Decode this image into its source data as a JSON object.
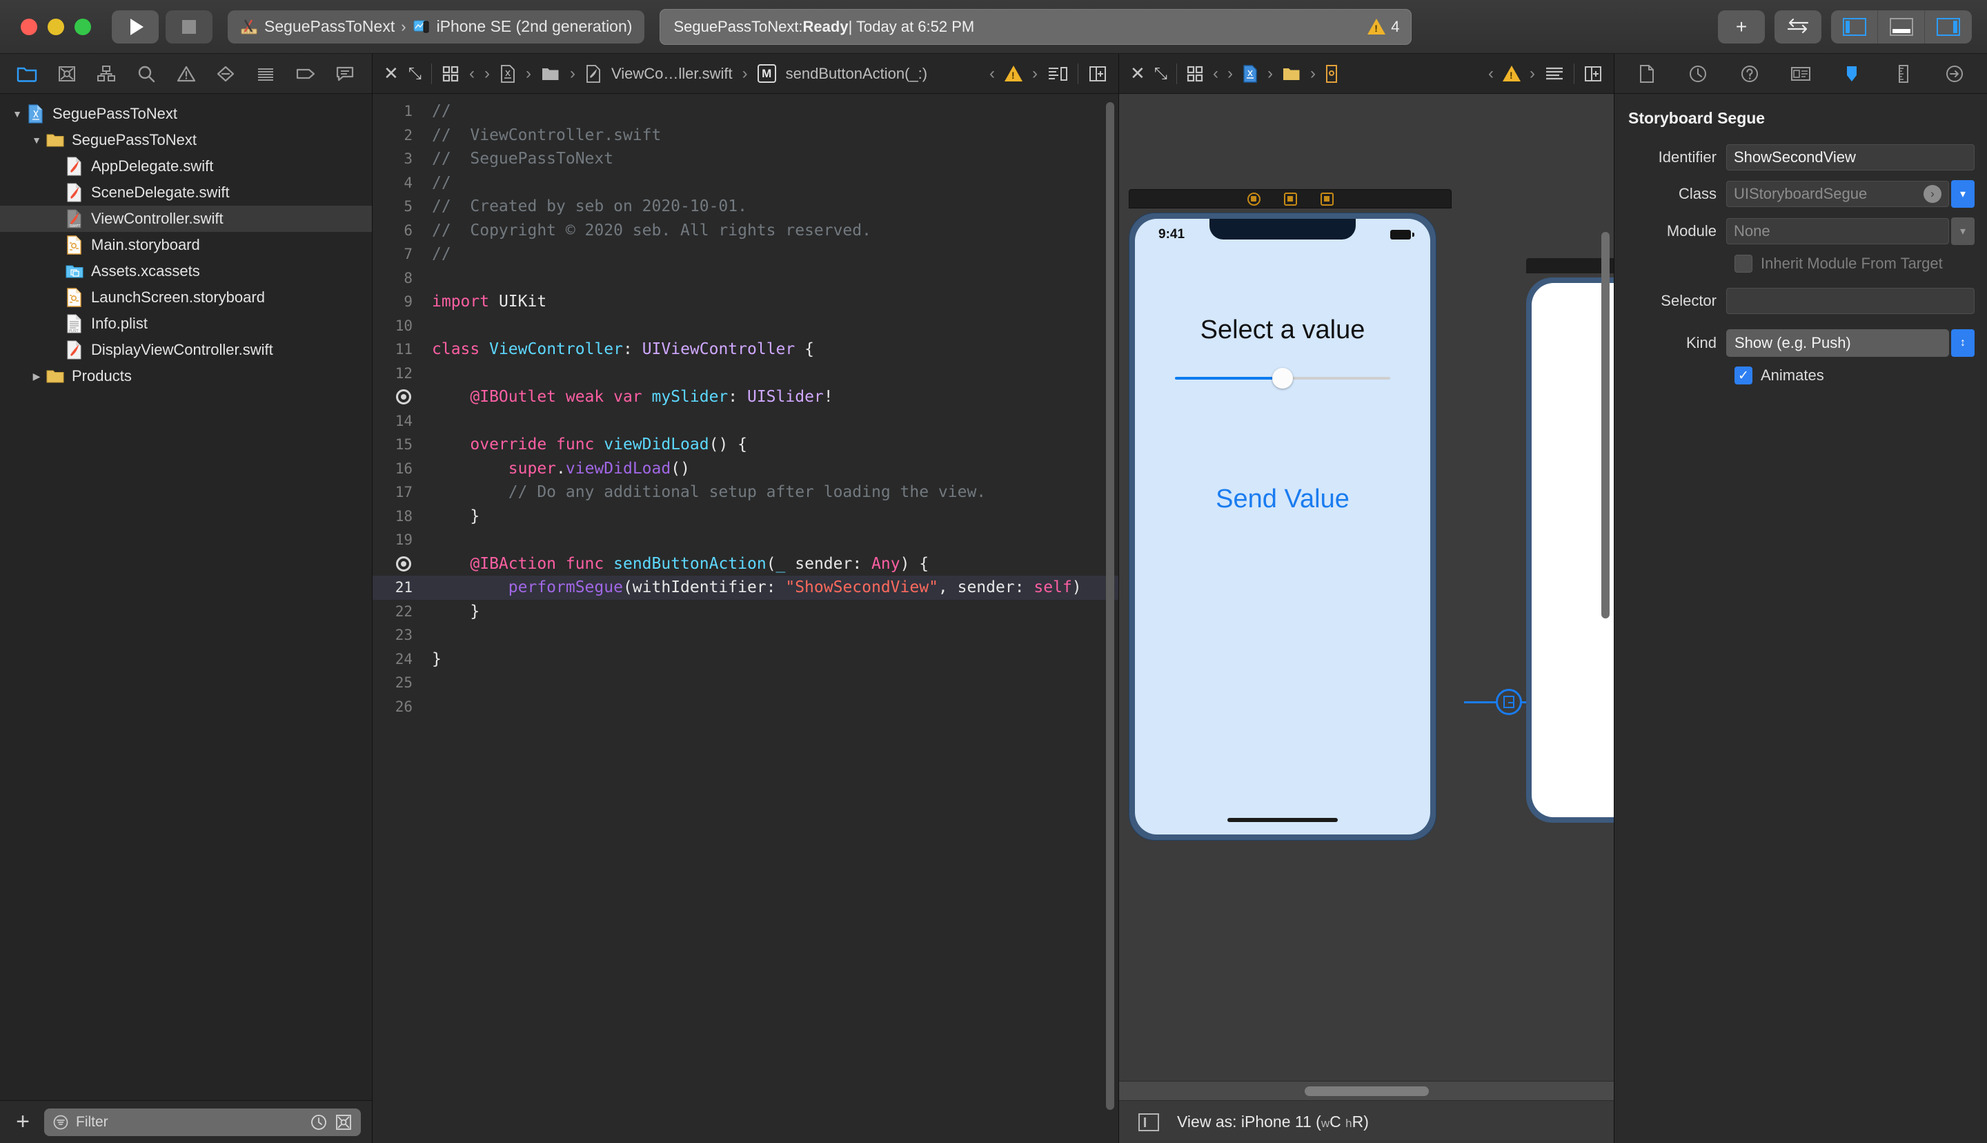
{
  "toolbar": {
    "run_label": "Run",
    "stop_label": "Stop",
    "scheme_project": "SeguePassToNext",
    "scheme_sep": "›",
    "scheme_device": "iPhone SE (2nd generation)",
    "status_project": "SeguePassToNext: ",
    "status_state": "Ready",
    "status_time": " | Today at 6:52 PM",
    "warning_count": "4",
    "add_label": "+",
    "toggle_label": "⇆",
    "pane_left_title": "Navigator",
    "pane_bottom_title": "Debug Area",
    "pane_right_title": "Inspector"
  },
  "navigator": {
    "tabs": [
      {
        "name": "folder-icon",
        "title": "Project navigator",
        "active": true
      },
      {
        "name": "source-control-icon",
        "title": "Source Control navigator",
        "active": false
      },
      {
        "name": "hierarchy-icon",
        "title": "Symbol navigator",
        "active": false
      },
      {
        "name": "search-icon",
        "title": "Find navigator",
        "active": false
      },
      {
        "name": "warning-triangle-icon",
        "title": "Issue navigator",
        "active": false
      },
      {
        "name": "test-diamond-icon",
        "title": "Test navigator",
        "active": false
      },
      {
        "name": "debug-list-icon",
        "title": "Debug navigator",
        "active": false
      },
      {
        "name": "tag-icon",
        "title": "Breakpoint navigator",
        "active": false
      },
      {
        "name": "report-bubble-icon",
        "title": "Report navigator",
        "active": false
      }
    ],
    "tree": [
      {
        "label": "SeguePassToNext",
        "indent": 0,
        "twisty": "down",
        "icon": "xcodeproj",
        "selected": false
      },
      {
        "label": "SeguePassToNext",
        "indent": 1,
        "twisty": "down",
        "icon": "folder",
        "selected": false
      },
      {
        "label": "AppDelegate.swift",
        "indent": 2,
        "twisty": "none",
        "icon": "swift",
        "selected": false
      },
      {
        "label": "SceneDelegate.swift",
        "indent": 2,
        "twisty": "none",
        "icon": "swift",
        "selected": false
      },
      {
        "label": "ViewController.swift",
        "indent": 2,
        "twisty": "none",
        "icon": "swift-gray",
        "selected": true
      },
      {
        "label": "Main.storyboard",
        "indent": 2,
        "twisty": "none",
        "icon": "storyboard",
        "selected": false
      },
      {
        "label": "Assets.xcassets",
        "indent": 2,
        "twisty": "none",
        "icon": "xcassets",
        "selected": false
      },
      {
        "label": "LaunchScreen.storyboard",
        "indent": 2,
        "twisty": "none",
        "icon": "storyboard",
        "selected": false
      },
      {
        "label": "Info.plist",
        "indent": 2,
        "twisty": "none",
        "icon": "plist",
        "selected": false
      },
      {
        "label": "DisplayViewController.swift",
        "indent": 2,
        "twisty": "none",
        "icon": "swift",
        "selected": false
      },
      {
        "label": "Products",
        "indent": 1,
        "twisty": "right",
        "icon": "folder",
        "selected": false
      }
    ],
    "filter": {
      "placeholder": "Filter",
      "value": "",
      "add_label": "+"
    }
  },
  "editor": {
    "jumpbar": {
      "close_label": "✕",
      "expand_label": "⤡",
      "crumb_file": "ViewCo…ller.swift",
      "crumb_symbol_badge": "M",
      "crumb_symbol": "sendButtonAction(_:)",
      "prev_label": "‹",
      "next_label": "›"
    },
    "lines": [
      {
        "n": "1",
        "marker": false,
        "hl": false,
        "tokens": [
          {
            "t": "//",
            "c": "comment"
          }
        ]
      },
      {
        "n": "2",
        "marker": false,
        "hl": false,
        "tokens": [
          {
            "t": "//  ViewController.swift",
            "c": "comment"
          }
        ]
      },
      {
        "n": "3",
        "marker": false,
        "hl": false,
        "tokens": [
          {
            "t": "//  SeguePassToNext",
            "c": "comment"
          }
        ]
      },
      {
        "n": "4",
        "marker": false,
        "hl": false,
        "tokens": [
          {
            "t": "//",
            "c": "comment"
          }
        ]
      },
      {
        "n": "5",
        "marker": false,
        "hl": false,
        "tokens": [
          {
            "t": "//  Created by seb on 2020-10-01.",
            "c": "comment"
          }
        ]
      },
      {
        "n": "6",
        "marker": false,
        "hl": false,
        "tokens": [
          {
            "t": "//  Copyright © 2020 seb. All rights reserved.",
            "c": "comment"
          }
        ]
      },
      {
        "n": "7",
        "marker": false,
        "hl": false,
        "tokens": [
          {
            "t": "//",
            "c": "comment"
          }
        ]
      },
      {
        "n": "8",
        "marker": false,
        "hl": false,
        "tokens": []
      },
      {
        "n": "9",
        "marker": false,
        "hl": false,
        "tokens": [
          {
            "t": "import",
            "c": "key"
          },
          {
            "t": " UIKit",
            "c": "plain"
          }
        ]
      },
      {
        "n": "10",
        "marker": false,
        "hl": false,
        "tokens": []
      },
      {
        "n": "11",
        "marker": false,
        "hl": false,
        "tokens": [
          {
            "t": "class",
            "c": "key"
          },
          {
            "t": " ",
            "c": "plain"
          },
          {
            "t": "ViewController",
            "c": "class"
          },
          {
            "t": ": ",
            "c": "plain"
          },
          {
            "t": "UIViewController",
            "c": "type"
          },
          {
            "t": " {",
            "c": "plain"
          }
        ]
      },
      {
        "n": "12",
        "marker": false,
        "hl": false,
        "tokens": []
      },
      {
        "n": "13",
        "marker": true,
        "hl": false,
        "tokens": [
          {
            "t": "    ",
            "c": "plain"
          },
          {
            "t": "@IBOutlet weak var",
            "c": "key"
          },
          {
            "t": " ",
            "c": "plain"
          },
          {
            "t": "mySlider",
            "c": "class"
          },
          {
            "t": ": ",
            "c": "plain"
          },
          {
            "t": "UISlider",
            "c": "type"
          },
          {
            "t": "!",
            "c": "plain"
          }
        ]
      },
      {
        "n": "14",
        "marker": false,
        "hl": false,
        "tokens": []
      },
      {
        "n": "15",
        "marker": false,
        "hl": false,
        "tokens": [
          {
            "t": "    ",
            "c": "plain"
          },
          {
            "t": "override func",
            "c": "key"
          },
          {
            "t": " ",
            "c": "plain"
          },
          {
            "t": "viewDidLoad",
            "c": "class"
          },
          {
            "t": "() {",
            "c": "plain"
          }
        ]
      },
      {
        "n": "16",
        "marker": false,
        "hl": false,
        "tokens": [
          {
            "t": "        ",
            "c": "plain"
          },
          {
            "t": "super",
            "c": "key"
          },
          {
            "t": ".",
            "c": "plain"
          },
          {
            "t": "viewDidLoad",
            "c": "call"
          },
          {
            "t": "()",
            "c": "plain"
          }
        ]
      },
      {
        "n": "17",
        "marker": false,
        "hl": false,
        "tokens": [
          {
            "t": "        // Do any additional setup after loading the view.",
            "c": "comment"
          }
        ]
      },
      {
        "n": "18",
        "marker": false,
        "hl": false,
        "tokens": [
          {
            "t": "    }",
            "c": "plain"
          }
        ]
      },
      {
        "n": "19",
        "marker": false,
        "hl": false,
        "tokens": []
      },
      {
        "n": "20",
        "marker": true,
        "hl": false,
        "tokens": [
          {
            "t": "    ",
            "c": "plain"
          },
          {
            "t": "@IBAction func",
            "c": "key"
          },
          {
            "t": " ",
            "c": "plain"
          },
          {
            "t": "sendButtonAction",
            "c": "class"
          },
          {
            "t": "(",
            "c": "plain"
          },
          {
            "t": "_",
            "c": "blue"
          },
          {
            "t": " sender: ",
            "c": "plain"
          },
          {
            "t": "Any",
            "c": "key"
          },
          {
            "t": ") {",
            "c": "plain"
          }
        ]
      },
      {
        "n": "21",
        "marker": false,
        "hl": true,
        "tokens": [
          {
            "t": "        ",
            "c": "plain"
          },
          {
            "t": "performSegue",
            "c": "call"
          },
          {
            "t": "(withIdentifier: ",
            "c": "plain"
          },
          {
            "t": "\"ShowSecondView\"",
            "c": "str"
          },
          {
            "t": ", sender: ",
            "c": "plain"
          },
          {
            "t": "self",
            "c": "key"
          },
          {
            "t": ")",
            "c": "plain"
          }
        ]
      },
      {
        "n": "22",
        "marker": false,
        "hl": false,
        "tokens": [
          {
            "t": "    }",
            "c": "plain"
          }
        ]
      },
      {
        "n": "23",
        "marker": false,
        "hl": false,
        "tokens": []
      },
      {
        "n": "24",
        "marker": false,
        "hl": false,
        "tokens": [
          {
            "t": "}",
            "c": "plain"
          }
        ]
      },
      {
        "n": "25",
        "marker": false,
        "hl": false,
        "tokens": []
      },
      {
        "n": "26",
        "marker": false,
        "hl": false,
        "tokens": []
      }
    ]
  },
  "storyboard": {
    "jumpbar": {
      "close_label": "✕",
      "expand_label": "⤡",
      "prev_label": "‹",
      "next_label": "›"
    },
    "scene": {
      "status_time": "9:41",
      "title_label": "Select a value",
      "button_label": "Send Value",
      "slider_value": 50
    },
    "bottom": {
      "view_as_prefix": "View as: iPhone 11 (",
      "view_as_w": "w",
      "view_as_wc": "C",
      "view_as_h": "h",
      "view_as_hr": "R",
      "view_as_suffix": ")"
    }
  },
  "inspector": {
    "tabs": [
      {
        "name": "file-inspector-icon",
        "active": false
      },
      {
        "name": "history-inspector-icon",
        "active": false
      },
      {
        "name": "quick-help-inspector-icon",
        "active": false
      },
      {
        "name": "identity-inspector-icon",
        "active": false
      },
      {
        "name": "attributes-inspector-icon",
        "active": true
      },
      {
        "name": "size-inspector-icon",
        "active": false
      },
      {
        "name": "connections-inspector-icon",
        "active": false
      }
    ],
    "section_title": "Storyboard Segue",
    "fields": {
      "identifier_label": "Identifier",
      "identifier_value": "ShowSecondView",
      "class_label": "Class",
      "class_value": "UIStoryboardSegue",
      "module_label": "Module",
      "module_value": "None",
      "inherit_label": "Inherit Module From Target",
      "inherit_checked": false,
      "selector_label": "Selector",
      "selector_value": "",
      "kind_label": "Kind",
      "kind_value": "Show (e.g. Push)",
      "animates_label": "Animates",
      "animates_checked": true
    }
  },
  "colors": {
    "accent_blue": "#2d7ff2",
    "warning_yellow": "#f0b429",
    "selection_gray": "#3a3a3a",
    "code_highlight": "#32333d",
    "screen_bg": "#d4e7fb"
  }
}
